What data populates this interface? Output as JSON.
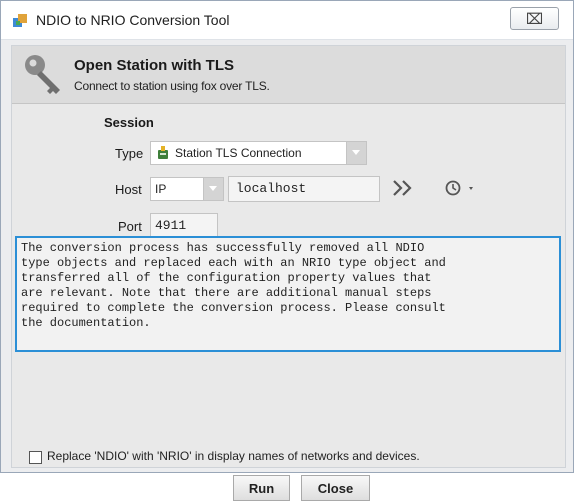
{
  "window": {
    "title": "NDIO to NRIO Conversion Tool",
    "close_glyph": "⌧"
  },
  "header": {
    "title": "Open Station with TLS",
    "subtitle": "Connect to station using fox over TLS."
  },
  "session": {
    "heading": "Session",
    "type_label": "Type",
    "type_value": "Station TLS Connection",
    "host_label": "Host",
    "host_protocol": "IP",
    "host_value": "localhost",
    "port_label": "Port",
    "port_value": "4911"
  },
  "message": "The conversion process has successfully removed all NDIO\ntype objects and replaced each with an NRIO type object and\ntransferred all of the configuration property values that\nare relevant. Note that there are additional manual steps\nrequired to complete the conversion process. Please consult\nthe documentation.",
  "option": {
    "label": "Replace 'NDIO' with 'NRIO' in display names of networks and devices.",
    "checked": false
  },
  "buttons": {
    "run": "Run",
    "close": "Close"
  },
  "icons": {
    "app": "niagara-app-icon",
    "key": "key-icon",
    "station": "station-connection-icon",
    "forward": "double-chevron-right-icon",
    "history": "clock-history-icon"
  },
  "colors": {
    "focus_border": "#2b8fd6"
  }
}
